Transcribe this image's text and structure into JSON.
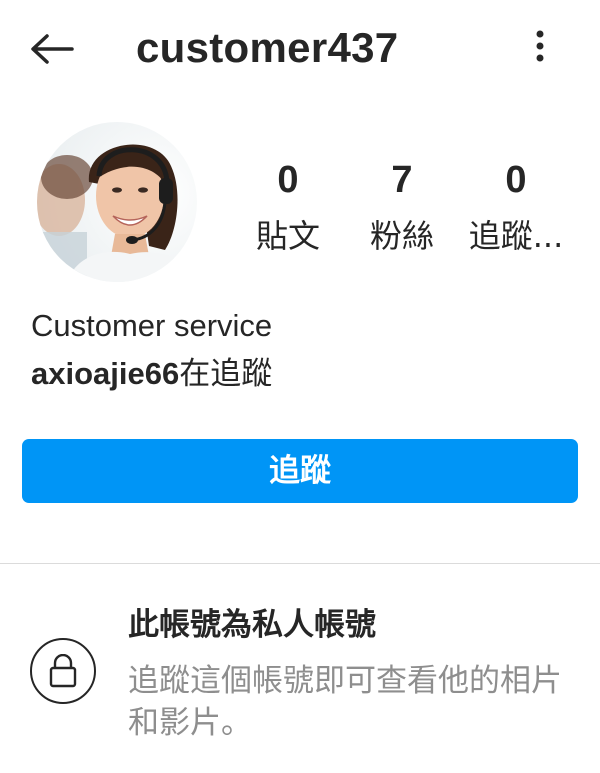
{
  "header": {
    "username": "customer437",
    "back_icon": "arrow-left-icon",
    "more_icon": "more-vertical-icon"
  },
  "profile": {
    "avatar_alt": "profile-photo",
    "stats": {
      "posts": {
        "value": "0",
        "label": "貼文"
      },
      "followers": {
        "value": "7",
        "label": "粉絲"
      },
      "following": {
        "value": "0",
        "label": "追蹤..."
      }
    }
  },
  "bio": {
    "name": "Customer service",
    "followed_by_user": "axioajie66",
    "followed_by_suffix": "在追蹤"
  },
  "actions": {
    "follow_label": "追蹤"
  },
  "private_notice": {
    "icon": "lock-icon",
    "title": "此帳號為私人帳號",
    "description": "追蹤這個帳號即可查看他的相片和影片。"
  },
  "colors": {
    "accent": "#0095f6",
    "text_primary": "#262626",
    "text_secondary": "#8e8e8e",
    "divider": "#dbdbdb"
  }
}
